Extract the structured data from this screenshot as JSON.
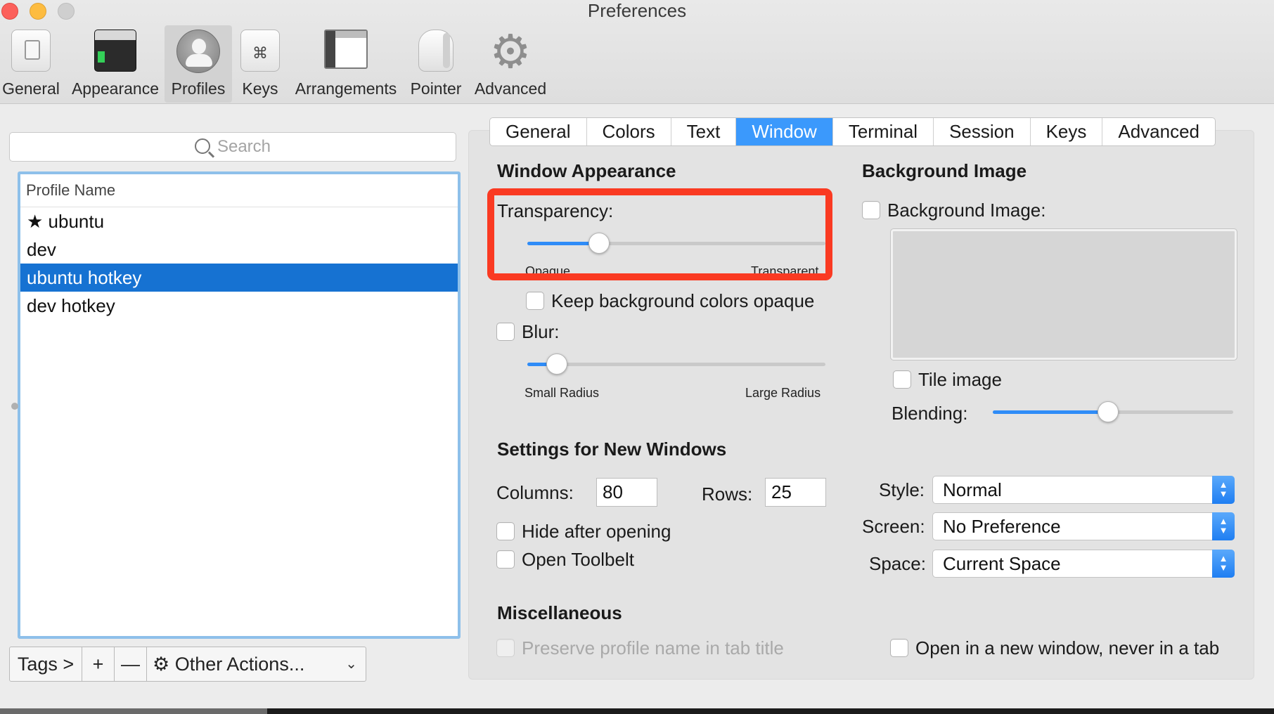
{
  "window": {
    "title": "Preferences"
  },
  "toolbar": {
    "items": [
      {
        "label": "General",
        "icon": "general-icon"
      },
      {
        "label": "Appearance",
        "icon": "appearance-icon"
      },
      {
        "label": "Profiles",
        "icon": "profiles-icon",
        "selected": true
      },
      {
        "label": "Keys",
        "icon": "keys-icon",
        "glyph": "⌘"
      },
      {
        "label": "Arrangements",
        "icon": "arrangements-icon"
      },
      {
        "label": "Pointer",
        "icon": "pointer-icon"
      },
      {
        "label": "Advanced",
        "icon": "gear-icon",
        "glyph": "⚙"
      }
    ]
  },
  "profiles": {
    "search_placeholder": "Search",
    "column_header": "Profile Name",
    "rows": [
      {
        "name": "★ ubuntu",
        "selected": false
      },
      {
        "name": "dev",
        "selected": false
      },
      {
        "name": "ubuntu hotkey",
        "selected": true
      },
      {
        "name": "dev hotkey",
        "selected": false
      }
    ],
    "bottom_bar": {
      "tags": "Tags >",
      "add": "+",
      "remove": "—",
      "other_actions": "Other Actions...",
      "other_actions_icon": "⚙",
      "chevron": "⌄"
    }
  },
  "tabs": {
    "items": [
      "General",
      "Colors",
      "Text",
      "Window",
      "Terminal",
      "Session",
      "Keys",
      "Advanced"
    ],
    "active": "Window"
  },
  "window_appearance": {
    "title": "Window Appearance",
    "transparency_label": "Transparency:",
    "transparency_value": 0.24,
    "transparency_min_label": "Opaque",
    "transparency_max_label": "Transparent",
    "keep_bg_opaque_label": "Keep background colors opaque",
    "keep_bg_opaque_checked": false,
    "blur_label": "Blur:",
    "blur_checked": false,
    "blur_value": 0.1,
    "blur_min_label": "Small Radius",
    "blur_max_label": "Large Radius"
  },
  "background_image": {
    "title": "Background Image",
    "checkbox_label": "Background Image:",
    "checked": false,
    "tile_label": "Tile image",
    "tile_checked": false,
    "blending_label": "Blending:",
    "blending_value": 0.48
  },
  "new_windows": {
    "title": "Settings for New Windows",
    "columns_label": "Columns:",
    "columns_value": "80",
    "rows_label": "Rows:",
    "rows_value": "25",
    "hide_after_opening_label": "Hide after opening",
    "open_toolbelt_label": "Open Toolbelt",
    "style_label": "Style:",
    "style_value": "Normal",
    "screen_label": "Screen:",
    "screen_value": "No Preference",
    "space_label": "Space:",
    "space_value": "Current Space"
  },
  "misc": {
    "title": "Miscellaneous",
    "preserve_label": "Preserve profile name in tab title",
    "preserve_enabled": false,
    "open_new_window_label": "Open in a new window, never in a tab"
  },
  "colors": {
    "accent": "#3b99fc",
    "selection": "#1672d2",
    "highlight_annotation": "#fa3a22",
    "slider_fill": "#2f8cf7"
  }
}
